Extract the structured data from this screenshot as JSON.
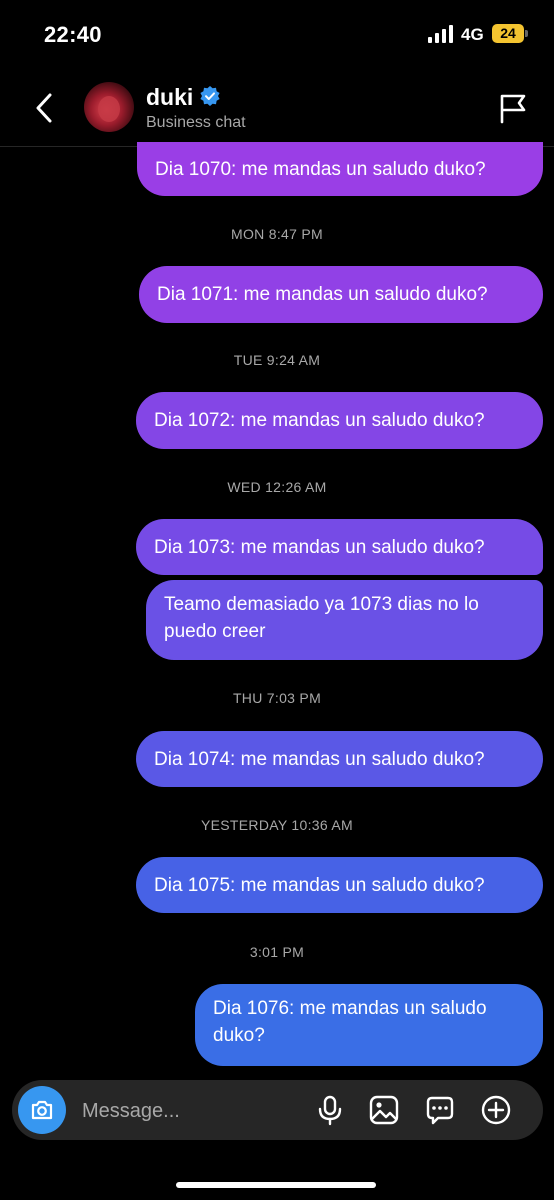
{
  "status": {
    "time": "22:40",
    "network": "4G",
    "battery": "24"
  },
  "header": {
    "name": "duki",
    "subtitle": "Business chat"
  },
  "messages": [
    {
      "text": "Dia 1070: me mandas un saludo duko?"
    },
    {
      "text": "Dia 1071: me mandas un saludo duko?"
    },
    {
      "text": "Dia 1072: me mandas un saludo duko?"
    },
    {
      "text": "Dia 1073: me mandas un saludo duko?"
    },
    {
      "text": "Teamo demasiado ya 1073 dias no lo puedo creer"
    },
    {
      "text": "Dia 1074: me mandas un saludo duko?"
    },
    {
      "text": "Dia 1075: me mandas un saludo duko?"
    },
    {
      "text": "Dia 1076: me mandas un saludo duko?"
    }
  ],
  "timestamps": [
    "MON 8:47 PM",
    "TUE 9:24 AM",
    "WED 12:26 AM",
    "THU 7:03 PM",
    "YESTERDAY 10:36 AM",
    "3:01 PM"
  ],
  "composer": {
    "placeholder": "Message..."
  },
  "icons": [
    "back-arrow",
    "verified-badge",
    "flag",
    "camera",
    "microphone",
    "gallery",
    "sticker",
    "add"
  ],
  "colors": {
    "bubble_top": "#9a3ee6",
    "bubble_mid": "#6b52e6",
    "bubble_bottom": "#3a6ee6",
    "accent": "#3797f0",
    "background": "#000000"
  }
}
